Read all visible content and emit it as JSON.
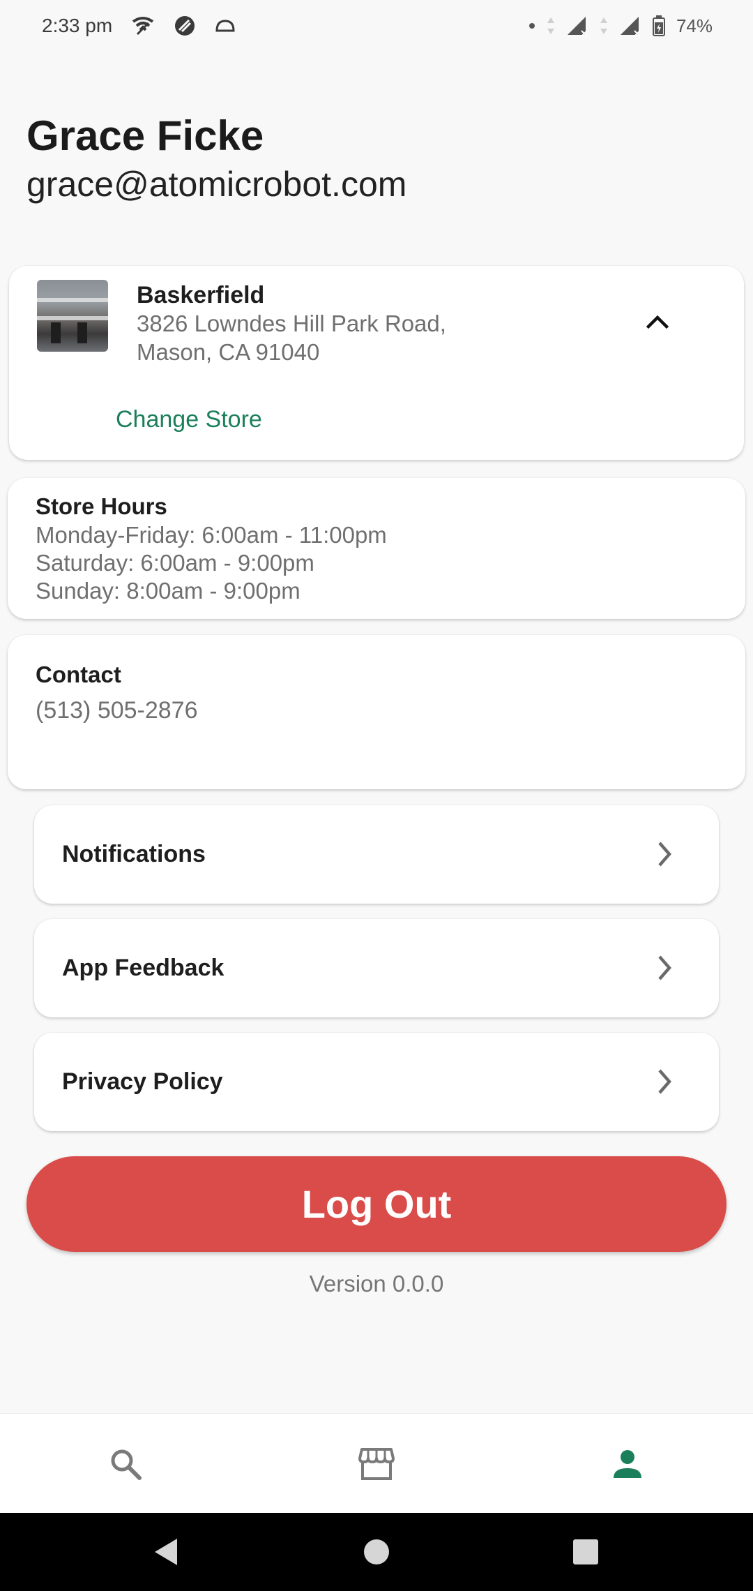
{
  "status_bar": {
    "time": "2:33 pm",
    "battery": "74%",
    "icons": [
      "wifi-calling-icon",
      "vpn-icon",
      "cloud-icon",
      "dot-icon",
      "signal-icon",
      "signal-icon",
      "battery-charging-icon"
    ]
  },
  "profile": {
    "name": "Grace Ficke",
    "email": "grace@atomicrobot.com"
  },
  "store": {
    "name": "Baskerfield",
    "address_line1": "3826 Lowndes Hill Park Road,",
    "address_line2": "Mason, CA 91040",
    "change_label": "Change Store",
    "expanded": true
  },
  "hours": {
    "title": "Store Hours",
    "lines": [
      "Monday-Friday: 6:00am - 11:00pm",
      "Saturday: 6:00am - 9:00pm",
      "Sunday: 8:00am - 9:00pm"
    ]
  },
  "contact": {
    "title": "Contact",
    "phone": "(513) 505-2876"
  },
  "menu": [
    {
      "label": "Notifications"
    },
    {
      "label": "App Feedback"
    },
    {
      "label": "Privacy Policy"
    }
  ],
  "logout_label": "Log Out",
  "version": "Version 0.0.0",
  "bottom_nav": {
    "items": [
      "search-icon",
      "store-icon",
      "profile-icon"
    ],
    "active": "profile-icon"
  },
  "colors": {
    "accent": "#1a7f5a",
    "logout": "#d94c4a",
    "background": "#f8f8f8"
  }
}
